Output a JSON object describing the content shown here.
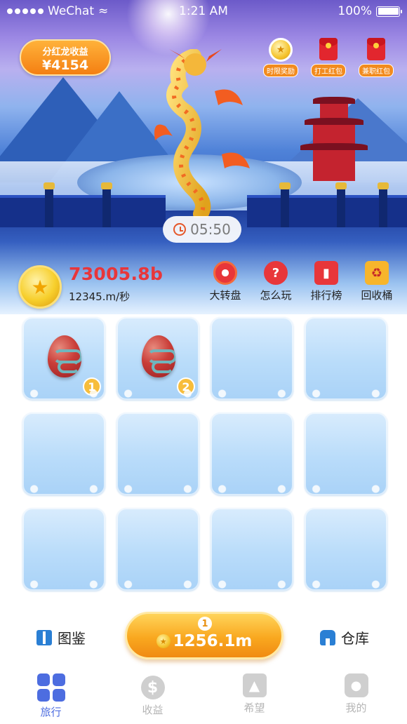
{
  "status_bar": {
    "carrier": "WeChat",
    "time": "1:21 AM",
    "battery": "100%"
  },
  "revenue_badge": {
    "label": "分红龙收益",
    "value": "¥4154"
  },
  "rewards": [
    {
      "label": "时限奖励",
      "icon": "coin-icon"
    },
    {
      "label": "打工红包",
      "icon": "red-packet-icon"
    },
    {
      "label": "兼职红包",
      "icon": "red-packet-icon"
    }
  ],
  "timer": "05:50",
  "balance": {
    "amount": "73005.8b",
    "rate": "12345.m/秒"
  },
  "actions": [
    {
      "label": "大转盘",
      "icon": "wheel-icon"
    },
    {
      "label": "怎么玩",
      "icon": "question-icon"
    },
    {
      "label": "排行榜",
      "icon": "ranking-icon"
    },
    {
      "label": "回收桶",
      "icon": "recycle-bin-icon"
    }
  ],
  "grid": {
    "cells": [
      {
        "egg": true,
        "level": "1"
      },
      {
        "egg": true,
        "level": "2"
      },
      {
        "egg": false
      },
      {
        "egg": false
      },
      {
        "egg": false
      },
      {
        "egg": false
      },
      {
        "egg": false
      },
      {
        "egg": false
      },
      {
        "egg": false
      },
      {
        "egg": false
      },
      {
        "egg": false
      },
      {
        "egg": false
      }
    ]
  },
  "bottom": {
    "handbook_label": "图鉴",
    "warehouse_label": "仓库",
    "buy_level": "1",
    "buy_cost": "1256.1m"
  },
  "tabs": [
    {
      "label": "旅行",
      "icon": "grid-icon",
      "active": true
    },
    {
      "label": "收益",
      "icon": "dollar-icon",
      "active": false
    },
    {
      "label": "希望",
      "icon": "thumbs-up-icon",
      "active": false
    },
    {
      "label": "我的",
      "icon": "user-icon",
      "active": false
    }
  ],
  "colors": {
    "accent": "#f08a12",
    "balance_red": "#e8363a",
    "tab_active": "#4d6de0"
  }
}
